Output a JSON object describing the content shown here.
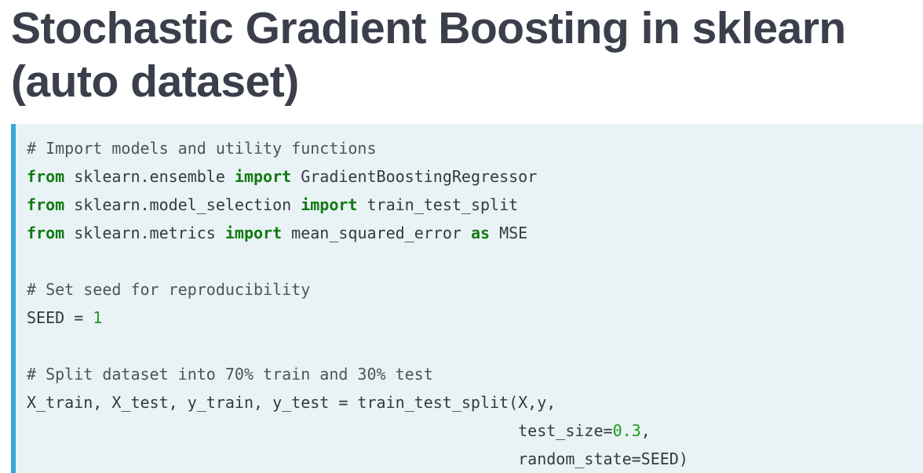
{
  "title": "Stochastic Gradient Boosting in sklearn (auto dataset)",
  "code": {
    "comment_import": "# Import models and utility functions",
    "line_ensemble": {
      "from": "from",
      "module": " sklearn.ensemble ",
      "import": "import",
      "names": " GradientBoostingRegressor"
    },
    "line_model_selection": {
      "from": "from",
      "module": " sklearn.model_selection ",
      "import": "import",
      "names": " train_test_split"
    },
    "line_metrics": {
      "from": "from",
      "module": " sklearn.metrics ",
      "import": "import",
      "names": " mean_squared_error ",
      "as": "as",
      "alias": " MSE"
    },
    "comment_seed": "# Set seed for reproducibility",
    "seed_line": {
      "lhs": "SEED = ",
      "value": "1"
    },
    "comment_split": "# Split dataset into 70% train and 30% test",
    "split_line_1": "X_train, X_test, y_train, y_test = train_test_split(X,y,",
    "split_line_2": {
      "indent": "                                                    ",
      "prefix": "test_size=",
      "value": "0.3",
      "suffix": ","
    },
    "split_line_3": "                                                    random_state=SEED)"
  }
}
